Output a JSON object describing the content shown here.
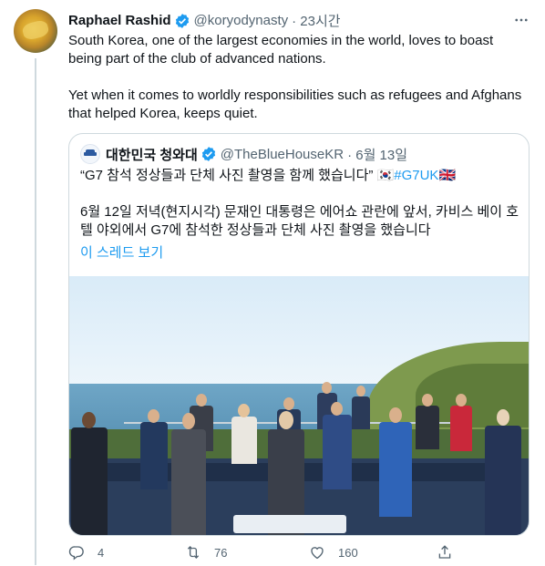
{
  "tweet": {
    "author_name": "Raphael Rashid",
    "author_handle": "@koryodynasty",
    "time": "· 23시간",
    "paragraphs": [
      "South Korea, one of the largest economies in the world, loves to boast being part of the club of advanced nations.",
      "Yet when it comes to worldly responsibilities such as refugees and Afghans that helped Korea, keeps quiet."
    ]
  },
  "quoted": {
    "author_name": "대한민국 청와대",
    "author_handle": "@TheBlueHouseKR",
    "time": "· 6월 13일",
    "line1_text": "“G7 참석 정상들과 단체 사진 촬영을 함께 했습니다” ",
    "line1_flags": "🇰🇷",
    "line1_hashtag": "#G7UK",
    "line1_flag2": "🇬🇧",
    "body": "6월 12일 저녁(현지시각) 문재인 대통령은 에어쇼 관란에 앞서, 카비스 베이 호텔 야외에서 G7에 참석한 정상들과 단체 사진 촬영을 했습니다",
    "show_thread": "이 스레드 보기",
    "photo_alt": "G7 leaders group photo"
  },
  "actions": {
    "replies": "4",
    "retweets": "76",
    "likes": "160"
  },
  "icons": {
    "verified": "verified-badge-icon",
    "more": "more-icon",
    "reply": "reply-icon",
    "retweet": "retweet-icon",
    "like": "heart-icon",
    "share": "share-icon"
  },
  "colors": {
    "accent": "#1d9bf0",
    "secondary_text": "#536471",
    "border": "#cfd9de"
  }
}
